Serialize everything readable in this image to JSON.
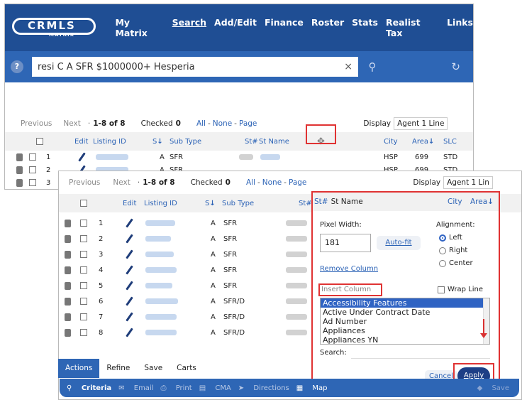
{
  "nav": {
    "logo_main": "CRMLS",
    "logo_sub": "MATRIX",
    "items": [
      "My Matrix",
      "Search",
      "Add/Edit",
      "Finance",
      "Roster",
      "Stats",
      "Realist Tax",
      "Links"
    ],
    "active": "Search"
  },
  "search": {
    "help": "?",
    "value": "resi C A SFR $1000000+ Hesperia",
    "clear": "×",
    "search_icon": "⚲",
    "history_icon": "↻"
  },
  "back": {
    "toolbar": {
      "previous": "Previous",
      "next": "Next",
      "range": "1-8 of 8",
      "checked_label": "Checked",
      "checked_count": "0",
      "all": "All",
      "none": "None",
      "page": "Page",
      "display_label": "Display",
      "display_value": "Agent 1 Line"
    },
    "headers": {
      "edit": "Edit",
      "listing_id": "Listing ID",
      "s": "S",
      "sub_type": "Sub Type",
      "st_num": "St#",
      "st_name": "St Name",
      "city": "City",
      "area": "Area",
      "slc": "SLC"
    },
    "move_icon": "✥",
    "rows": [
      {
        "n": "1",
        "s": "A",
        "type": "SFR",
        "city": "HSP",
        "area": "699",
        "slc": "STD"
      },
      {
        "n": "2",
        "s": "A",
        "type": "SFR",
        "city": "HSP",
        "area": "699",
        "slc": "STD"
      },
      {
        "n": "3"
      }
    ]
  },
  "front": {
    "toolbar": {
      "previous": "Previous",
      "next": "Next",
      "range": "1-8 of 8",
      "checked_label": "Checked",
      "checked_count": "0",
      "all": "All",
      "none": "None",
      "page": "Page",
      "display_label": "Display",
      "display_value": "Agent 1 Lin"
    },
    "headers": {
      "edit": "Edit",
      "listing_id": "Listing ID",
      "s": "S",
      "sub_type": "Sub Type",
      "st_num": "St#",
      "st_name": "St Name",
      "city": "City",
      "area": "Area"
    },
    "rows": [
      {
        "n": "1",
        "s": "A",
        "type": "SFR"
      },
      {
        "n": "2",
        "s": "A",
        "type": "SFR"
      },
      {
        "n": "3",
        "s": "A",
        "type": "SFR"
      },
      {
        "n": "4",
        "s": "A",
        "type": "SFR"
      },
      {
        "n": "5",
        "s": "A",
        "type": "SFR"
      },
      {
        "n": "6",
        "s": "A",
        "type": "SFR/D"
      },
      {
        "n": "7",
        "s": "A",
        "type": "SFR/D"
      },
      {
        "n": "8",
        "s": "A",
        "type": "SFR/D"
      }
    ]
  },
  "popup": {
    "pixel_width_label": "Pixel Width:",
    "pixel_width_value": "181",
    "autofit": "Auto-fit",
    "alignment_label": "Alignment:",
    "align_left": "Left",
    "align_right": "Right",
    "align_center": "Center",
    "align_selected": "Left",
    "remove_column": "Remove Column",
    "insert_column": "Insert Column",
    "wrap_line": "Wrap Line",
    "options": [
      "Accessibility Features",
      "Active Under Contract Date",
      "Ad Number",
      "Appliances",
      "Appliances YN"
    ],
    "selected_option": "Accessibility Features",
    "search_label": "Search:",
    "cancel": "Cancel",
    "apply": "Apply"
  },
  "tabs": [
    "Actions",
    "Refine",
    "Save",
    "Carts"
  ],
  "actions": [
    "Criteria",
    "Email",
    "Print",
    "CMA",
    "Directions",
    "Map",
    "Save"
  ],
  "colors": {
    "nav_bg": "#1f4e94",
    "search_bg": "#2e66b5",
    "link": "#2c63b6",
    "highlight": "#e03333",
    "apply_bg": "#1d3f86",
    "selected_option": "#2f63c3"
  }
}
